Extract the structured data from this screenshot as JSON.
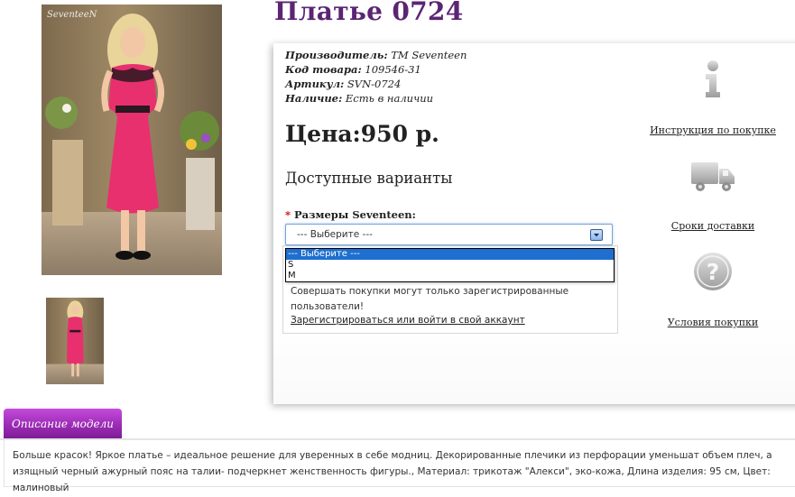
{
  "photo": {
    "logo": "SeventeeN"
  },
  "product": {
    "title": "Платье 0724"
  },
  "meta": [
    {
      "key": "Производитель:",
      "value": "TM Seventeen"
    },
    {
      "key": "Код товара:",
      "value": "109546-31"
    },
    {
      "key": "Артикул:",
      "value": "SVN-0724"
    },
    {
      "key": "Наличие:",
      "value": "Есть в наличии"
    }
  ],
  "price": {
    "label": "Цена:950 р."
  },
  "options": {
    "heading": "Доступные варианты",
    "required_mark": "*",
    "size_label": "Размеры Seventeen:",
    "selected_value": "--- Выберите ---",
    "items": [
      "--- Выберите ---",
      "S",
      "M"
    ]
  },
  "login": {
    "notice": "Совершать покупки могут только зарегистрированные пользователи!",
    "link": "Зарегистрироваться или войти в свой аккаунт"
  },
  "sidebar": [
    {
      "icon": "info-icon",
      "label": "Инструкция по покупке"
    },
    {
      "icon": "truck-icon",
      "label": "Сроки доставки"
    },
    {
      "icon": "question-icon",
      "label": "Условия покупки"
    }
  ],
  "colors": {
    "title": "#5b2573",
    "tab": "#9b2bb4",
    "dress": "#e8306f",
    "select_highlight": "#1e6fd0"
  },
  "description": {
    "tab_label": "Описание модели",
    "text": "Больше красок! Яркое платье – идеальное решение для уверенных в себе модниц. Декорированные плечики из перфорации уменьшат объем плеч, а изящный черный ажурный пояс на талии- подчеркнет женственность фигуры., Материал: трикотаж \"Алекси\", эко-кожа, Длина изделия: 95 см, Цвет: малиновый"
  }
}
